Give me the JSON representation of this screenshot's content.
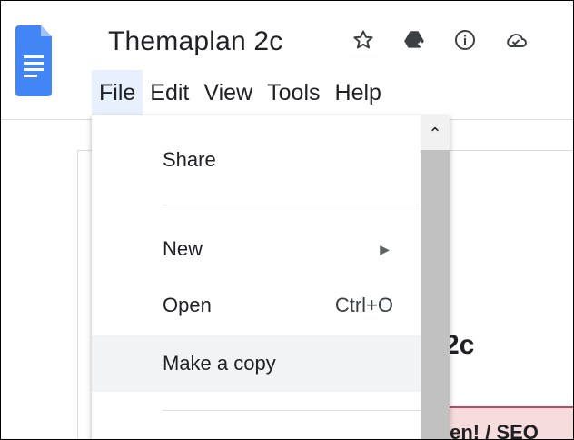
{
  "app": {
    "doc_title": "Themaplan 2c",
    "icons": [
      "star-icon",
      "drive-move-icon",
      "info-icon",
      "cloud-saved-icon"
    ]
  },
  "menubar": {
    "items": [
      "File",
      "Edit",
      "View",
      "Tools",
      "Help"
    ],
    "active": "File"
  },
  "file_menu": {
    "items": [
      {
        "label": "Share"
      },
      {
        "label": "New"
      },
      {
        "label": "Open",
        "shortcut": "Ctrl+O"
      },
      {
        "label": "Make a copy"
      }
    ]
  },
  "document": {
    "heading_fragment": "2c",
    "pink_fragment": "ien! / SEO"
  }
}
